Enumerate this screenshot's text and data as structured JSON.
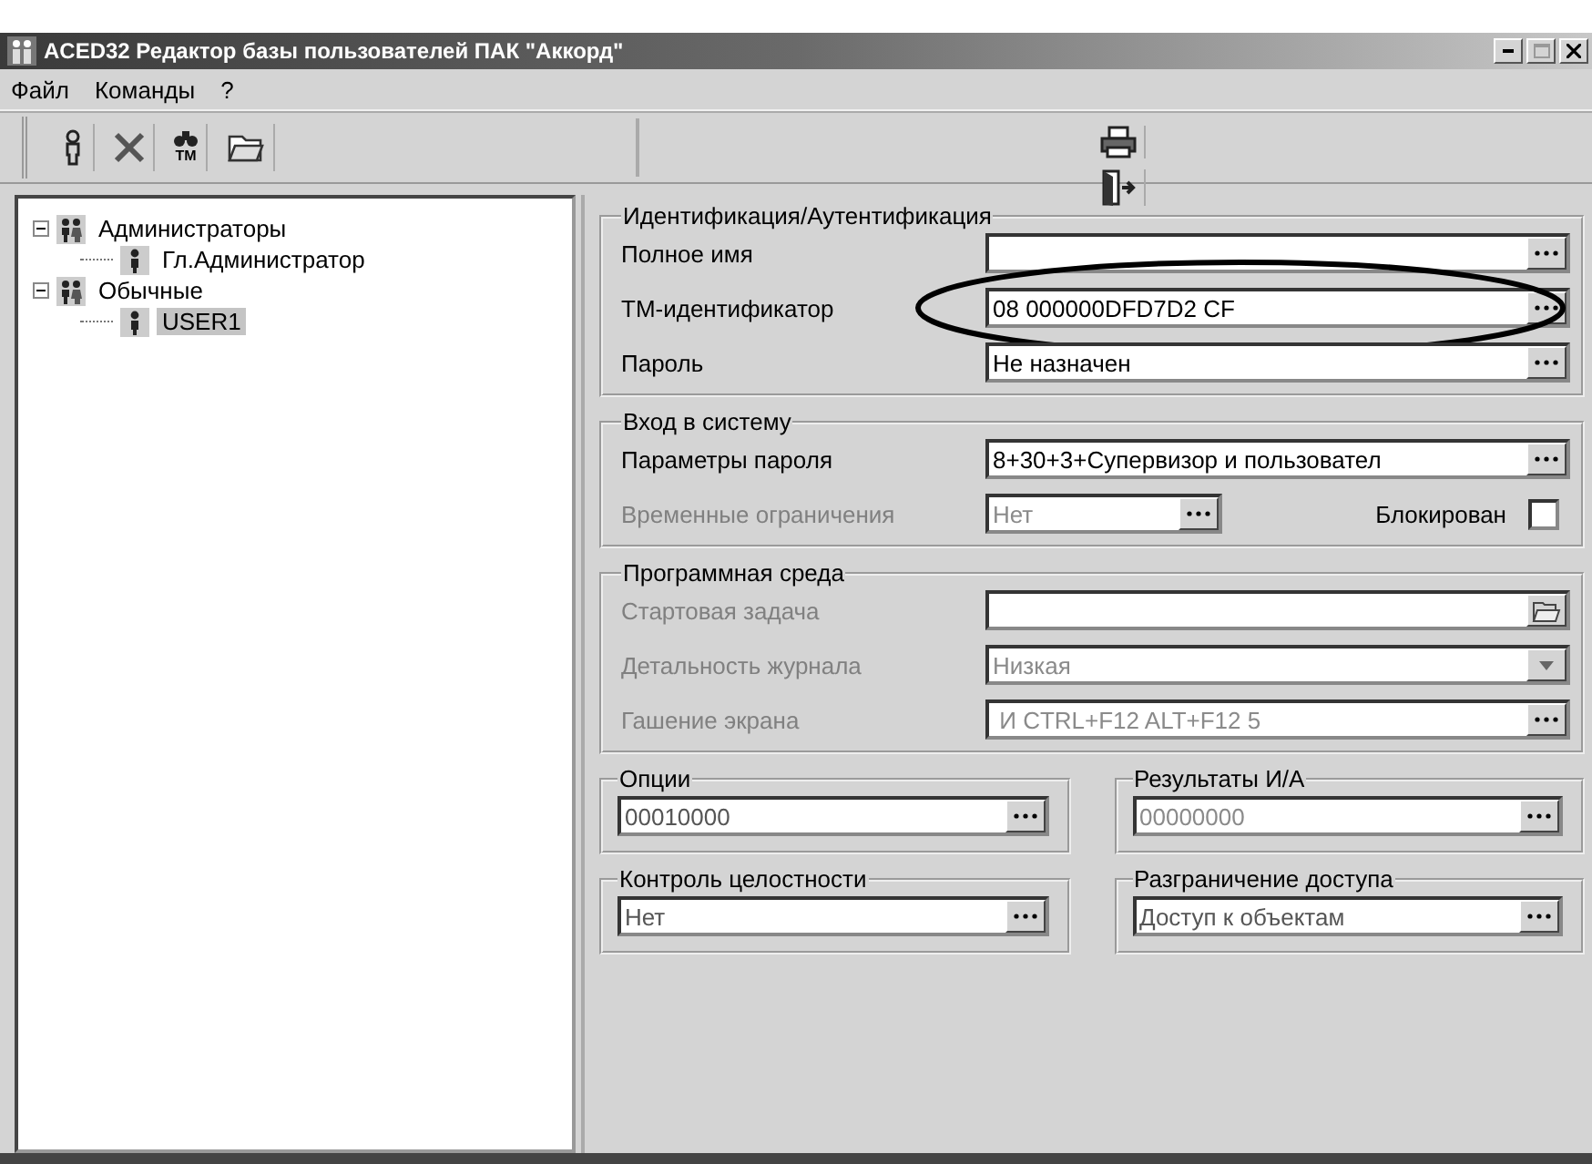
{
  "window": {
    "title": "ACED32 Редактор базы пользователей ПАК \"Аккорд\""
  },
  "menu": [
    "Файл",
    "Команды",
    "?"
  ],
  "toolbar": {
    "left": [
      {
        "kind": "user"
      },
      {
        "kind": "delete"
      },
      {
        "kind": "binoculars",
        "badge": "TM"
      },
      {
        "kind": "folder"
      }
    ],
    "right": [
      {
        "kind": "printer"
      },
      {
        "kind": "exit"
      }
    ]
  },
  "tree": [
    {
      "label": "Администраторы",
      "kind": "group",
      "expanded": true,
      "selected": false,
      "children": [
        {
          "label": "Гл.Администратор",
          "kind": "user",
          "selected": false
        }
      ]
    },
    {
      "label": "Обычные",
      "kind": "group",
      "expanded": true,
      "selected": false,
      "children": [
        {
          "label": "USER1",
          "kind": "user",
          "selected": true
        }
      ]
    }
  ],
  "identification": {
    "title": "Идентификация/Аутентификация",
    "fields": [
      {
        "label": "Полное имя",
        "disabled": false,
        "kind": "ellipsis",
        "circled": false
      },
      {
        "label": "ТМ-идентификатор",
        "value": "08 000000DFD7D2 CF",
        "disabled": false,
        "kind": "ellipsis",
        "circled": true
      },
      {
        "label": "Пароль",
        "value": "Не назначен",
        "disabled": false,
        "kind": "ellipsis",
        "circled": false
      }
    ]
  },
  "login": {
    "title": "Вход в систему",
    "fields": [
      {
        "label": "Параметры пароля",
        "value": "8+30+3+Супервизор и пользовател",
        "disabled": false,
        "kind": "ellipsis",
        "circled": false
      },
      {
        "label": "Временные ограничения",
        "value": "Нет",
        "disabled": true,
        "kind": "ellipsis",
        "circled": false
      }
    ],
    "blocked": {
      "label": "Блокирован",
      "checked": false
    }
  },
  "environment": {
    "title": "Программная среда",
    "fields": [
      {
        "label": "Стартовая задача",
        "disabled": true,
        "kind": "folder",
        "circled": false
      },
      {
        "label": "Детальность журнала",
        "value": "Низкая",
        "disabled": true,
        "kind": "dropdown",
        "circled": false
      },
      {
        "label": "Гашение экрана",
        "value": " И CTRL+F12 ALT+F12 5",
        "disabled": true,
        "kind": "ellipsis",
        "circled": false
      }
    ]
  },
  "small_groups": [
    {
      "title": "Опции",
      "value": "00010000",
      "disabled": false
    },
    {
      "title": "Результаты И/А",
      "value": "00000000",
      "disabled": true
    },
    {
      "title": "Контроль целостности",
      "value": "Нет",
      "disabled": false
    },
    {
      "title": "Разграничение доступа",
      "value": "Доступ к объектам",
      "disabled": false
    }
  ]
}
